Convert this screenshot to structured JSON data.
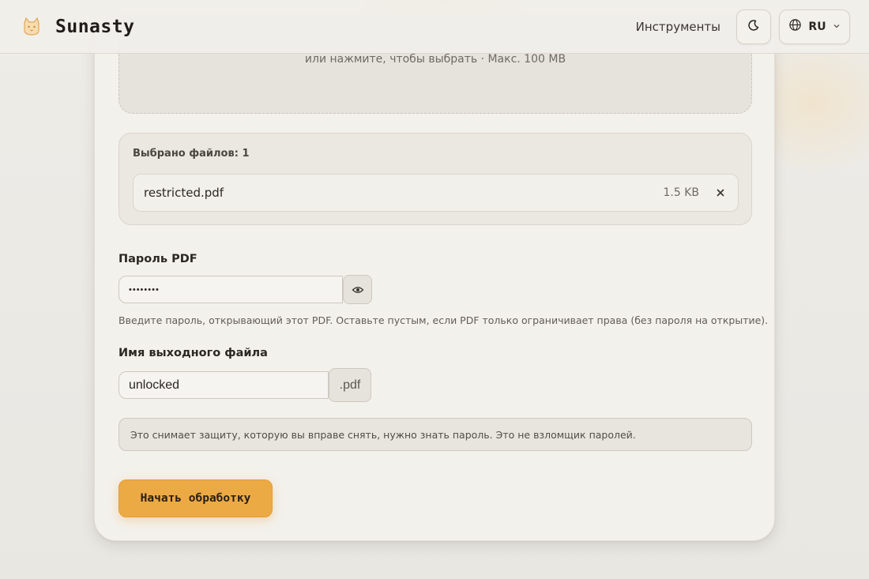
{
  "header": {
    "brand": "Sunasty",
    "nav_tools": "Инструменты",
    "lang": "RU",
    "logo_icon": "cat-logo-icon",
    "theme_icon": "moon-icon",
    "lang_icon": "globe-icon"
  },
  "dropzone": {
    "hint": "или нажмите, чтобы выбрать · Макс. 100 MB"
  },
  "files": {
    "count_label": "Выбрано файлов: 1",
    "items": [
      {
        "name": "restricted.pdf",
        "size": "1.5 KB"
      }
    ]
  },
  "password": {
    "label": "Пароль PDF",
    "value": "••••••••",
    "help": "Введите пароль, открывающий этот PDF. Оставьте пустым, если PDF только ограничивает права (без пароля на открытие)."
  },
  "output": {
    "label": "Имя выходного файла",
    "value": "unlocked",
    "extension": ".pdf"
  },
  "notice": "Это снимает защиту, которую вы вправе снять, нужно знать пароль. Это не взломщик паролей.",
  "actions": {
    "start_label": "Начать обработку"
  },
  "colors": {
    "accent": "#ecaa45",
    "background": "#ebe9e4",
    "card": "#f3f1ec"
  }
}
